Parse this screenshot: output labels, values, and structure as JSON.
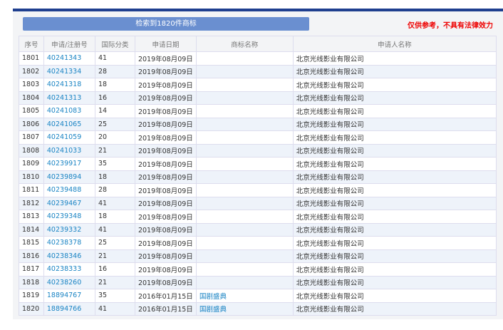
{
  "search_button": "检索到1820件商标",
  "disclaimer": "仅供参考，不具有法律效力",
  "columns": [
    "序号",
    "申请/注册号",
    "国际分类",
    "申请日期",
    "商标名称",
    "申请人名称"
  ],
  "rows": [
    [
      "1801",
      "40241343",
      "41",
      "2019年08月09日",
      "",
      "北京光线影业有限公司"
    ],
    [
      "1802",
      "40241334",
      "28",
      "2019年08月09日",
      "",
      "北京光线影业有限公司"
    ],
    [
      "1803",
      "40241318",
      "18",
      "2019年08月09日",
      "",
      "北京光线影业有限公司"
    ],
    [
      "1804",
      "40241313",
      "16",
      "2019年08月09日",
      "",
      "北京光线影业有限公司"
    ],
    [
      "1805",
      "40241083",
      "14",
      "2019年08月09日",
      "",
      "北京光线影业有限公司"
    ],
    [
      "1806",
      "40241065",
      "25",
      "2019年08月09日",
      "",
      "北京光线影业有限公司"
    ],
    [
      "1807",
      "40241059",
      "20",
      "2019年08月09日",
      "",
      "北京光线影业有限公司"
    ],
    [
      "1808",
      "40241033",
      "21",
      "2019年08月09日",
      "",
      "北京光线影业有限公司"
    ],
    [
      "1809",
      "40239917",
      "35",
      "2019年08月09日",
      "",
      "北京光线影业有限公司"
    ],
    [
      "1810",
      "40239894",
      "18",
      "2019年08月09日",
      "",
      "北京光线影业有限公司"
    ],
    [
      "1811",
      "40239488",
      "28",
      "2019年08月09日",
      "",
      "北京光线影业有限公司"
    ],
    [
      "1812",
      "40239467",
      "41",
      "2019年08月09日",
      "",
      "北京光线影业有限公司"
    ],
    [
      "1813",
      "40239348",
      "18",
      "2019年08月09日",
      "",
      "北京光线影业有限公司"
    ],
    [
      "1814",
      "40239332",
      "41",
      "2019年08月09日",
      "",
      "北京光线影业有限公司"
    ],
    [
      "1815",
      "40238378",
      "25",
      "2019年08月09日",
      "",
      "北京光线影业有限公司"
    ],
    [
      "1816",
      "40238346",
      "21",
      "2019年08月09日",
      "",
      "北京光线影业有限公司"
    ],
    [
      "1817",
      "40238333",
      "16",
      "2019年08月09日",
      "",
      "北京光线影业有限公司"
    ],
    [
      "1818",
      "40238260",
      "21",
      "2019年08月09日",
      "",
      "北京光线影业有限公司"
    ],
    [
      "1819",
      "18894767",
      "35",
      "2016年01月15日",
      "国剧盛典",
      "北京光线影业有限公司"
    ],
    [
      "1820",
      "18894766",
      "41",
      "2016年01月15日",
      "国剧盛典",
      "北京光线影业有限公司"
    ]
  ]
}
